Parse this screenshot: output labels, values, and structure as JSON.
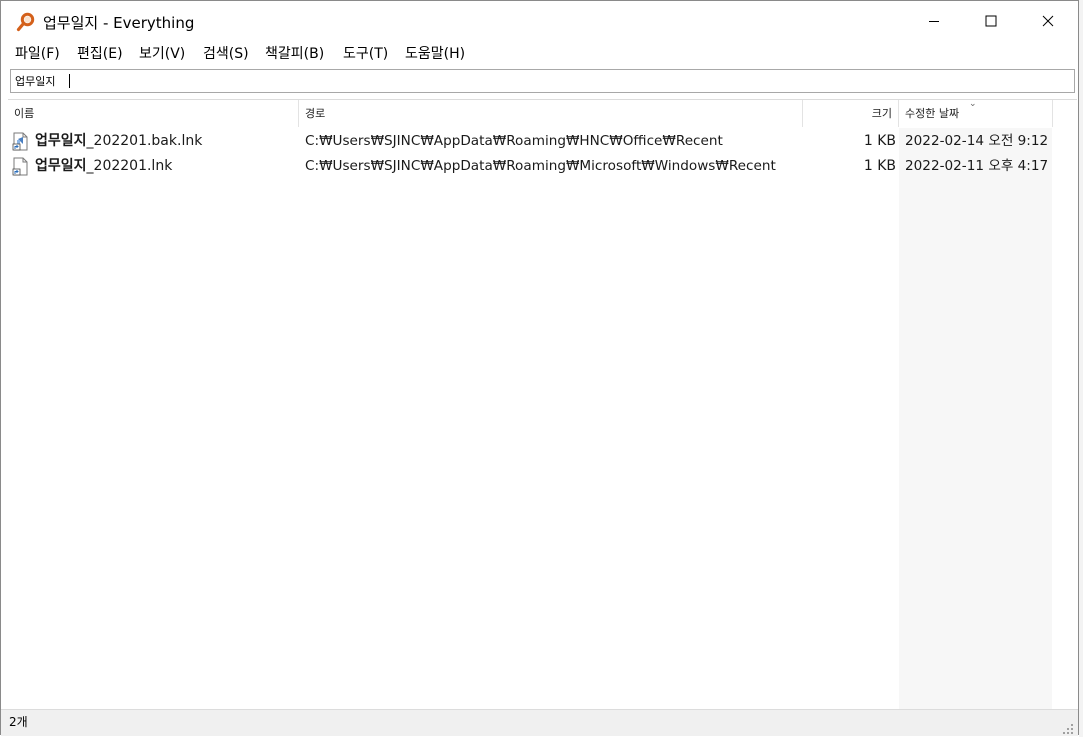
{
  "window": {
    "title": "업무일지 - Everything",
    "buttons": {
      "minimize": "minimize",
      "maximize": "maximize",
      "close": "close"
    }
  },
  "menu": [
    {
      "label": "파일(F)"
    },
    {
      "label": "편집(E)"
    },
    {
      "label": "보기(V)"
    },
    {
      "label": "검색(S)"
    },
    {
      "label": "책갈피(B)"
    },
    {
      "label": "도구(T)"
    },
    {
      "label": "도움말(H)"
    }
  ],
  "search": {
    "value": "업무일지"
  },
  "columns": {
    "name": "이름",
    "path": "경로",
    "size": "크기",
    "modified": "수정한 날짜",
    "sorted_by": "modified"
  },
  "files": [
    {
      "name_stem": "업무일지",
      "name_rest": "_202201.bak.lnk",
      "path": "C:₩Users₩SJINC₩AppData₩Roaming₩HNC₩Office₩Recent",
      "size": "1 KB",
      "modified": "2022-02-14 오전 9:12",
      "icon": "shortcut-file-icon"
    },
    {
      "name_stem": "업무일지",
      "name_rest": "_202201.lnk",
      "path": "C:₩Users₩SJINC₩AppData₩Roaming₩Microsoft₩Windows₩Recent",
      "size": "1 KB",
      "modified": "2022-02-11 오후 4:17",
      "icon": "shortcut-file-icon"
    }
  ],
  "status": {
    "count": "2개"
  },
  "colors": {
    "app_icon": "#d4601a",
    "shortcut_arrow": "#2a6ebb"
  }
}
